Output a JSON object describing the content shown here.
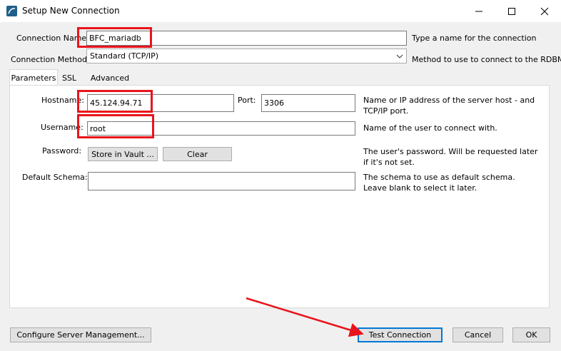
{
  "window": {
    "title": "Setup New Connection",
    "controls": [
      "minimize-icon",
      "maximize-icon",
      "close-icon"
    ]
  },
  "connection_name": {
    "label": "Connection Name:",
    "value": "BFC_mariadb",
    "hint": "Type a name for the connection"
  },
  "connection_method": {
    "label": "Connection Method:",
    "value": "Standard (TCP/IP)",
    "hint": "Method to use to connect to the RDBMS"
  },
  "tabs": [
    {
      "label": "Parameters",
      "active": true
    },
    {
      "label": "SSL",
      "active": false
    },
    {
      "label": "Advanced",
      "active": false
    }
  ],
  "parameters": {
    "hostname": {
      "label": "Hostname:",
      "value": "45.124.94.71",
      "hint": "Name or IP address of the server host - and TCP/IP port."
    },
    "port": {
      "label": "Port:",
      "value": "3306"
    },
    "username": {
      "label": "Username:",
      "value": "root",
      "hint": "Name of the user to connect with."
    },
    "password": {
      "label": "Password:",
      "store_button": "Store in Vault ...",
      "clear_button": "Clear",
      "hint": "The user's password. Will be requested later if it's not set."
    },
    "default_schema": {
      "label": "Default Schema:",
      "value": "",
      "hint": "The schema to use as default schema. Leave blank to select it later."
    }
  },
  "footer": {
    "configure_button": "Configure Server Management...",
    "test_button": "Test Connection",
    "cancel_button": "Cancel",
    "ok_button": "OK"
  },
  "annotations": {
    "color": "#e8141c"
  }
}
